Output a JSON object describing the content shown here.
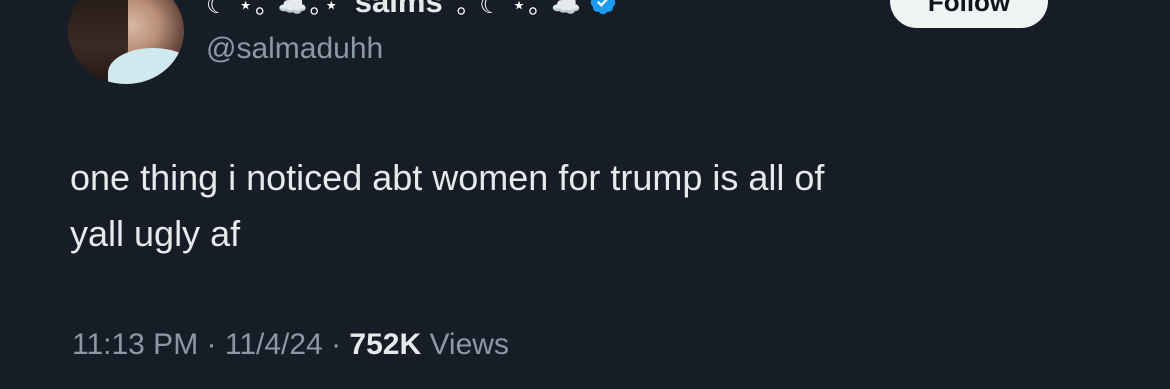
{
  "user": {
    "display_name": "salms",
    "name_decor_left": "☾ ⋆｡ ☁️｡⋆",
    "name_decor_right": "｡ ☾ ⋆｡ ☁️",
    "handle": "@salmaduhh",
    "verified": true,
    "verified_color": "#1d9bf0"
  },
  "actions": {
    "follow_label": "Follow"
  },
  "tweet": {
    "text_line1": "one thing i noticed abt women for trump is all of",
    "text_line2": "yall ugly af"
  },
  "meta": {
    "time": "11:13 PM",
    "sep1": " · ",
    "date": "11/4/24",
    "sep2": " · ",
    "views_count": "752K",
    "views_label": " Views"
  }
}
